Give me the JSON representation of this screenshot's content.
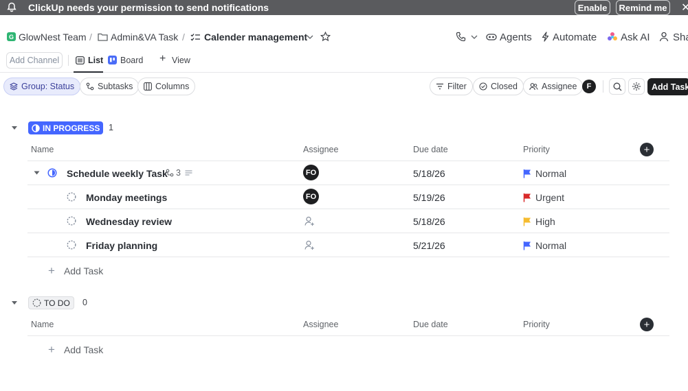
{
  "notification": {
    "message": "ClickUp needs your permission to send notifications",
    "enable_label": "Enable",
    "remind_label": "Remind me"
  },
  "breadcrumb": {
    "workspace_initial": "G",
    "workspace": "GlowNest Team",
    "folder": "Admin&VA Task",
    "list": "Calender management"
  },
  "top_actions": {
    "agents": "Agents",
    "automate": "Automate",
    "ask_ai": "Ask AI",
    "share": "Sha"
  },
  "views": {
    "add_channel": "Add Channel",
    "list": "List",
    "board": "Board",
    "view": "View"
  },
  "toolbar": {
    "group": "Group: Status",
    "subtasks": "Subtasks",
    "columns": "Columns",
    "filter": "Filter",
    "closed": "Closed",
    "assignee": "Assignee",
    "me_initial": "F",
    "add_task": "Add Task"
  },
  "columns": {
    "name": "Name",
    "assignee": "Assignee",
    "due": "Due date",
    "priority": "Priority"
  },
  "groups": [
    {
      "status": "IN PROGRESS",
      "count": "1",
      "color": "#4466ff",
      "parent": {
        "name": "Schedule weekly Task",
        "subtask_count": "3",
        "assignee": "FO",
        "due": "5/18/26",
        "priority": "Normal",
        "priority_color": "#4466ff"
      },
      "tasks": [
        {
          "name": "Monday meetings",
          "assignee": "FO",
          "due": "5/19/26",
          "priority": "Urgent",
          "priority_color": "#d82a2a"
        },
        {
          "name": "Wednesday review",
          "assignee": "",
          "due": "5/18/26",
          "priority": "High",
          "priority_color": "#f6bc2f"
        },
        {
          "name": "Friday planning",
          "assignee": "",
          "due": "5/21/26",
          "priority": "Normal",
          "priority_color": "#4466ff"
        }
      ],
      "add_task": "Add Task"
    },
    {
      "status": "TO DO",
      "count": "0",
      "color": "#87909e",
      "add_task": "Add Task"
    }
  ]
}
